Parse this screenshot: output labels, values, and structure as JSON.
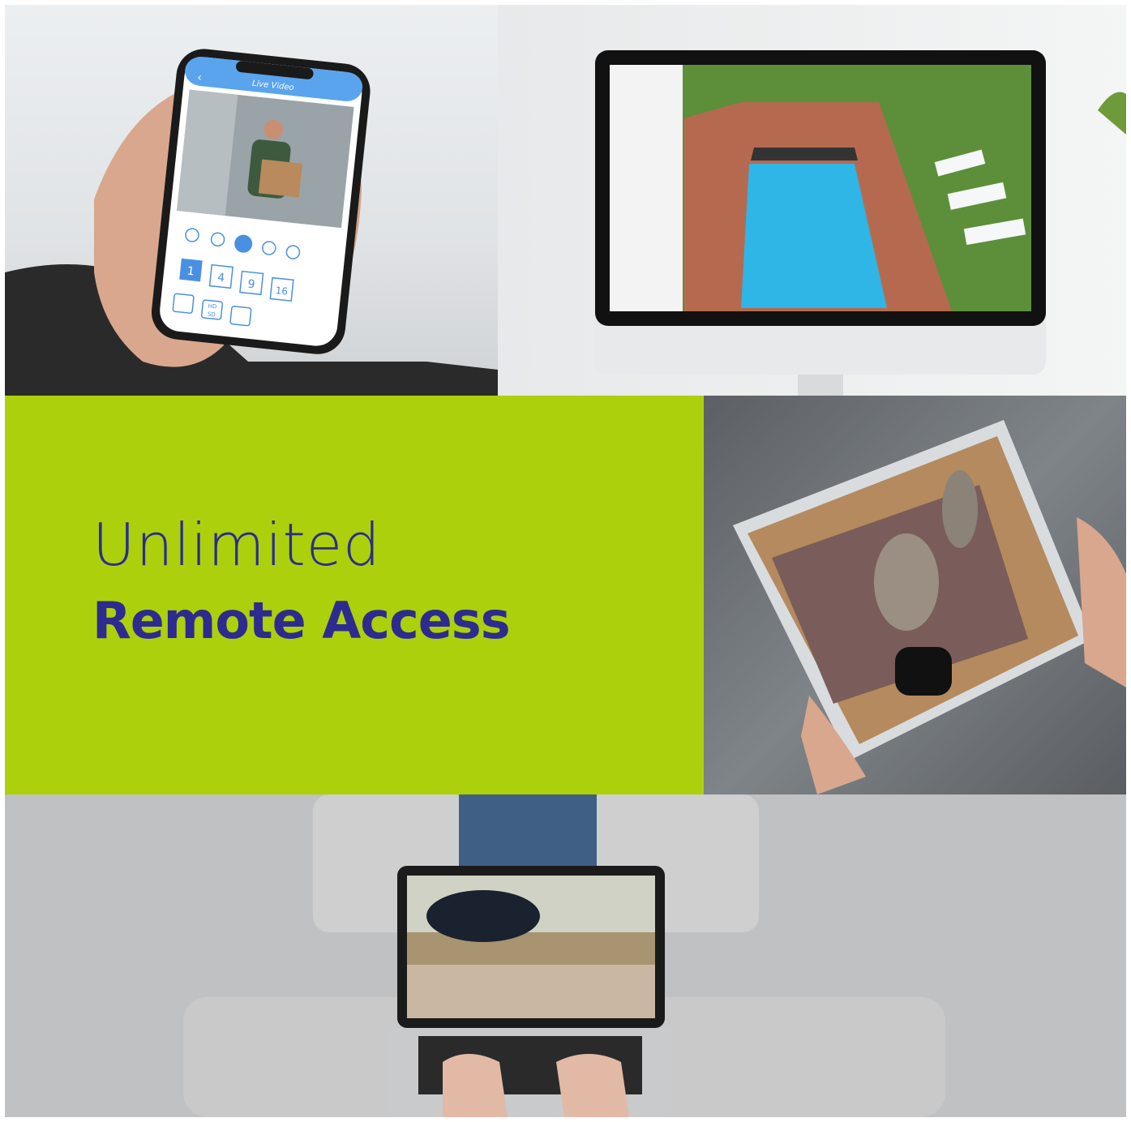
{
  "headline": {
    "line1": "Unlimited",
    "line2": "Remote Access"
  },
  "phone_app": {
    "screen_title": "Live Video",
    "grid_buttons": [
      "1",
      "4",
      "9",
      "16"
    ],
    "badge_hd": "HD",
    "badge_sd": "SD"
  },
  "colors": {
    "accent_green": "#acd00c",
    "headline_navy": "#2d2b8f",
    "app_blue": "#4a90e2",
    "pool_water": "#2fb6e6"
  }
}
